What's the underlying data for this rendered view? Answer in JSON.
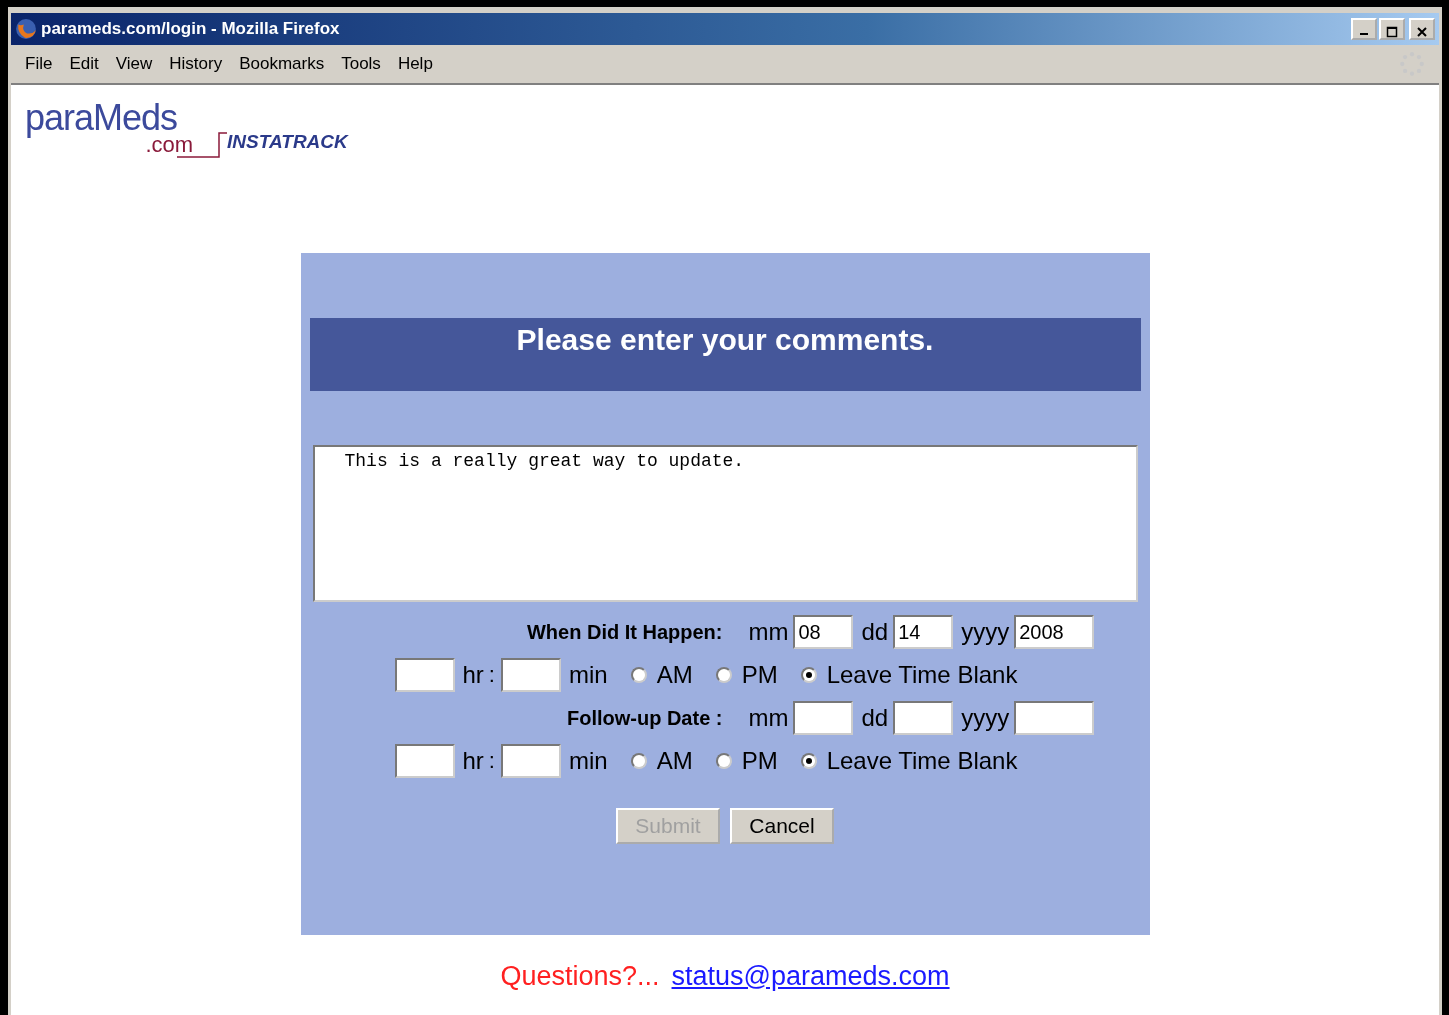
{
  "window": {
    "title": "parameds.com/login - Mozilla Firefox"
  },
  "menu": [
    "File",
    "Edit",
    "View",
    "History",
    "Bookmarks",
    "Tools",
    "Help"
  ],
  "logo": {
    "name": "paraMeds",
    "domain": ".com",
    "product": "INSTATRACK"
  },
  "form": {
    "heading": "Please enter your comments.",
    "comments": "This is a really great way to update.",
    "events": [
      {
        "label": "When Did It Happen:",
        "date": [
          {
            "unit": "mm",
            "value": "08"
          },
          {
            "unit": "dd",
            "value": "14"
          },
          {
            "unit": "yyyy",
            "value": "2008"
          }
        ],
        "hr_label": "hr",
        "separator": ":",
        "min_label": "min",
        "options": [
          {
            "label": "AM",
            "selected": false
          },
          {
            "label": "PM",
            "selected": false
          },
          {
            "label": "Leave Time Blank",
            "selected": true
          }
        ]
      },
      {
        "label": "Follow-up Date :",
        "date": [
          {
            "unit": "mm"
          },
          {
            "unit": "dd"
          },
          {
            "unit": "yyyy"
          }
        ],
        "hr_label": "hr",
        "separator": ":",
        "min_label": "min",
        "options": [
          {
            "label": "AM",
            "selected": false
          },
          {
            "label": "PM",
            "selected": false
          },
          {
            "label": "Leave Time Blank",
            "selected": true
          }
        ]
      }
    ],
    "buttons": [
      {
        "label": "Submit",
        "disabled": true
      },
      {
        "label": "Cancel",
        "disabled": false
      }
    ]
  },
  "footer": {
    "question": "Questions?...",
    "email": "status@parameds.com"
  }
}
